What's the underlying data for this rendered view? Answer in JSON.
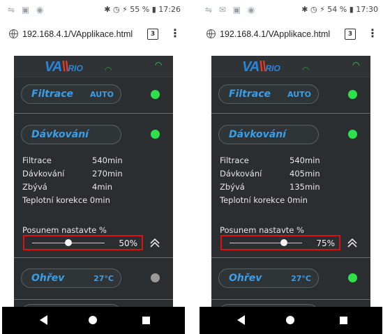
{
  "phones": [
    {
      "status": {
        "left_icons": "⇋ ▣ ◉",
        "right": "✱ ◷ ⚡ 55 % ▮ 17:26"
      },
      "url": "192.168.4.1/VApplikace.html",
      "tab_count": "3",
      "logo": {
        "main": "VA",
        "sub": "RIO"
      },
      "filtrace": {
        "label": "Filtrace",
        "value": "AUTO",
        "led_color": "#2ee04a"
      },
      "davkovani": {
        "label": "Dávkování",
        "led_color": "#2ee04a"
      },
      "info": [
        {
          "key": "Filtrace",
          "value": "540min"
        },
        {
          "key": "Dávkování",
          "value": "270min"
        },
        {
          "key": "Zbývá",
          "value": "4min"
        },
        {
          "key": "Teplotní korekce",
          "value": "0min"
        }
      ],
      "slider": {
        "label": "Posunem nastavte %",
        "value_text": "50%",
        "fraction": 0.5
      },
      "ohrev": {
        "label": "Ohřev",
        "value": "27°C",
        "led_color": "#9a9a9a"
      }
    },
    {
      "status": {
        "left_icons": "⇋ ✉ ▣ ◉",
        "right": "✱ ◷ ⚡ 54 % ▮ 17:30"
      },
      "url": "192.168.4.1/VApplikace.html",
      "tab_count": "3",
      "logo": {
        "main": "VA",
        "sub": "RIO"
      },
      "filtrace": {
        "label": "Filtrace",
        "value": "AUTO",
        "led_color": "#2ee04a"
      },
      "davkovani": {
        "label": "Dávkování",
        "led_color": "#2ee04a"
      },
      "info": [
        {
          "key": "Filtrace",
          "value": "540min"
        },
        {
          "key": "Dávkování",
          "value": "405min"
        },
        {
          "key": "Zbývá",
          "value": "135min"
        },
        {
          "key": "Teplotní korekce",
          "value": "0min"
        }
      ],
      "slider": {
        "label": "Posunem nastavte %",
        "value_text": "75%",
        "fraction": 0.75
      },
      "ohrev": {
        "label": "Ohřev",
        "value": "27°C",
        "led_color": "#2ee04a"
      }
    }
  ],
  "colors": {
    "accent_blue": "#3b9ee8",
    "highlight_red": "#e01010"
  }
}
